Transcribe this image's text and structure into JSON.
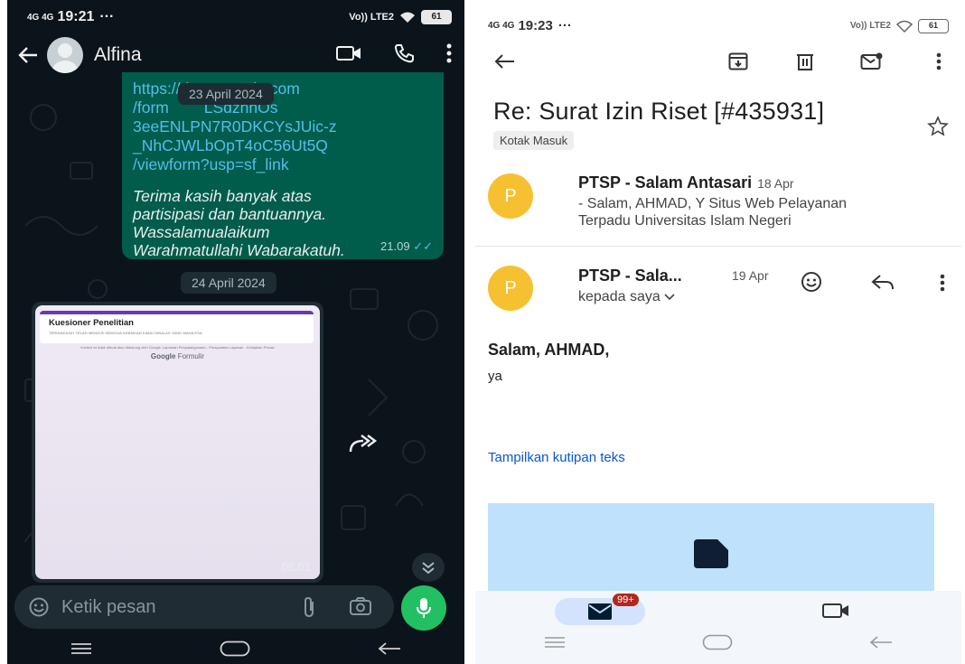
{
  "whatsapp": {
    "status": {
      "signal": "4G 4G",
      "time": "19:21",
      "dots": "···",
      "volte": "Vo)) LTE2",
      "battery": "61"
    },
    "header": {
      "contact_name": "Alfina"
    },
    "outgoing_message": {
      "link_lines": "https://docs.google.com\n/form        LSdznhOs\n3eeENLPN7R0DKCYsJUic-z\n_NhCJWLbOpT4oC56Ut5Q\n/viewform?usp=sf_link",
      "text": "Terima kasih banyak atas\npartisipasi dan bantuannya.\nWassalamualaikum\nWarahmatullahi Wabarakatuh.",
      "time": "21.09",
      "ticks": "✓✓"
    },
    "date_pill_1": "23 April 2024",
    "date_pill_2": "24 April 2024",
    "image_message": {
      "form_title": "Kuesioner Penelitian",
      "form_subtitle": "TERIMAKASIH TELAH MENGISI SEMOGA KEBAIKAN KAMU DIBALAS YANG MAHA ESA",
      "form_footer": "Konten ini tidak dibuat atau didukung oleh Google. Laporkan Penyalahgunaan - Persyaratan Layanan - Kebijakan Privasi",
      "brand_google": "Google",
      "brand_forms": "Formulir",
      "time": "08.01"
    },
    "composer": {
      "placeholder": "Ketik pesan"
    }
  },
  "gmail": {
    "status": {
      "signal": "4G 4G",
      "time": "19:23",
      "dots": "···",
      "volte": "Vo)) LTE2",
      "battery": "61"
    },
    "subject": "Re: Surat Izin Riset [#435931]",
    "label": "Kotak Masuk",
    "message_1": {
      "avatar_letter": "P",
      "sender": "PTSP - Salam Antasari",
      "date": "18 Apr",
      "snippet": "- Salam, AHMAD, Y Situs Web Pelayanan\nTerpadu Universitas Islam Negeri"
    },
    "message_2": {
      "avatar_letter": "P",
      "sender": "PTSP - Sala...",
      "date": "19 Apr",
      "recipient": "kepada saya",
      "greeting": "Salam, AHMAD,",
      "body": "ya",
      "show_quoted": "Tampilkan kutipan teks"
    },
    "bottom_nav": {
      "mail_badge": "99+"
    }
  },
  "colors": {
    "wa_bg": "#0b141a",
    "wa_bubble_out": "#005c4b",
    "wa_link": "#53bdeb",
    "wa_green": "#21c063",
    "gmail_avatar": "#f6c131",
    "gmail_link": "#0b57d0",
    "gmail_badge": "#b3261e"
  }
}
